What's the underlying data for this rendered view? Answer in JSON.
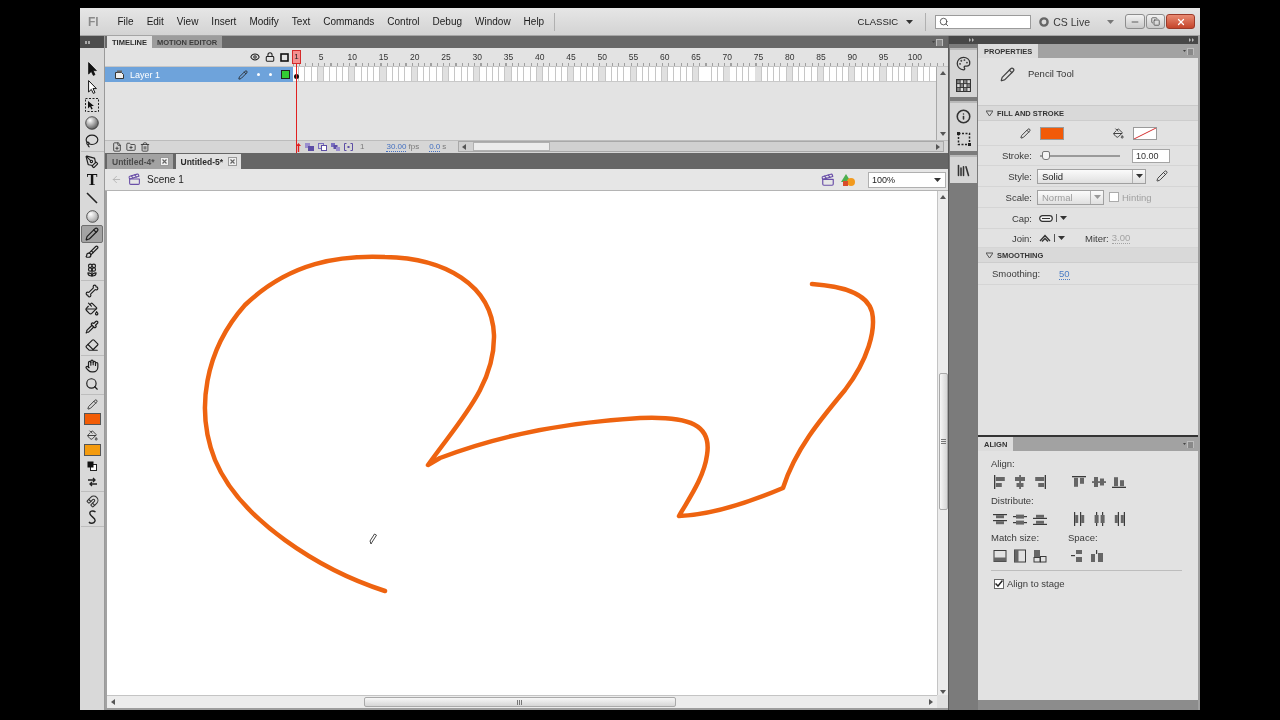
{
  "menu_bar": {
    "logo": "Fl",
    "menus": [
      "File",
      "Edit",
      "View",
      "Insert",
      "Modify",
      "Text",
      "Commands",
      "Control",
      "Debug",
      "Window",
      "Help"
    ],
    "workspace": "CLASSIC",
    "cs_live": "CS Live"
  },
  "toolbar": {
    "tool_groups": [
      {
        "tools": [
          {
            "kind": "selection",
            "selected": false
          },
          {
            "kind": "subselection",
            "selected": false
          },
          {
            "kind": "free-transform",
            "selected": false
          },
          {
            "kind": "rotation-3d",
            "selected": false
          },
          {
            "kind": "lasso",
            "selected": false
          }
        ]
      },
      {
        "tools": [
          {
            "kind": "pen",
            "selected": false
          },
          {
            "kind": "text",
            "glyph": "T",
            "selected": false
          },
          {
            "kind": "line",
            "selected": false
          },
          {
            "kind": "oval",
            "selected": false
          },
          {
            "kind": "pencil",
            "selected": true
          },
          {
            "kind": "brush",
            "selected": false
          },
          {
            "kind": "deco",
            "selected": false
          }
        ]
      },
      {
        "tools": [
          {
            "kind": "bone",
            "selected": false
          },
          {
            "kind": "paint-bucket",
            "selected": false
          },
          {
            "kind": "eyedropper",
            "selected": false
          },
          {
            "kind": "eraser",
            "selected": false
          }
        ]
      },
      {
        "tools": [
          {
            "kind": "hand",
            "selected": false
          },
          {
            "kind": "zoom",
            "selected": false
          }
        ]
      }
    ],
    "swatches": [
      {
        "kind": "stroke",
        "color": "#f25c05"
      },
      {
        "kind": "fill",
        "color": "#f49b0e"
      }
    ],
    "options": [
      {
        "kind": "snap"
      },
      {
        "kind": "smooth"
      }
    ]
  },
  "timeline": {
    "tabs": [
      {
        "label": "TIMELINE",
        "selected": true
      },
      {
        "label": "MOTION EDITOR",
        "selected": false
      }
    ],
    "playhead": "1",
    "frame_numbers": [
      "5",
      "10",
      "15",
      "20",
      "25",
      "30",
      "35",
      "40",
      "45",
      "50",
      "55",
      "60",
      "65",
      "70",
      "75",
      "80",
      "85",
      "90",
      "95",
      "100"
    ],
    "layers": [
      {
        "name": "Layer 1",
        "selected": true,
        "color": "#33cc33"
      }
    ],
    "current_frame": "1",
    "frame_rate": {
      "value": "30.00",
      "unit": "fps"
    },
    "elapsed": {
      "value": "0.0",
      "unit": "s"
    }
  },
  "documents": {
    "tabs": [
      {
        "label": "Untitled-4*",
        "selected": false
      },
      {
        "label": "Untitled-5*",
        "selected": true
      }
    ]
  },
  "scene_bar": {
    "scene": "Scene 1",
    "zoom": "100%"
  },
  "properties": {
    "title": "PROPERTIES",
    "tool_name": "Pencil Tool",
    "fill_and_stroke": {
      "title": "FILL AND STROKE",
      "expanded": true,
      "swatches": [
        {
          "kind": "stroke",
          "empty": false,
          "color": "#f25a08"
        },
        {
          "kind": "fill",
          "empty": true
        }
      ],
      "stroke": {
        "label": "Stroke:",
        "level": 0.03,
        "value": "10.00"
      },
      "style": {
        "label": "Style:",
        "value": "Solid"
      },
      "scale": {
        "label": "Scale:",
        "value": "Normal",
        "disabled": true
      },
      "hinting": {
        "label": "Hinting",
        "checked": false,
        "disabled": true
      },
      "cap": {
        "label": "Cap:"
      },
      "join": {
        "label": "Join:"
      },
      "miter": {
        "label": "Miter:",
        "value": "3.00",
        "disabled": true
      }
    },
    "smoothing": {
      "title": "SMOOTHING",
      "expanded": true,
      "label": "Smoothing:",
      "value": "50"
    }
  },
  "align": {
    "title": "ALIGN",
    "align_label": "Align:",
    "distribute_label": "Distribute:",
    "match_size_label": "Match size:",
    "space_label": "Space:",
    "align_to_stage": {
      "label": "Align to stage",
      "checked": true
    }
  }
}
